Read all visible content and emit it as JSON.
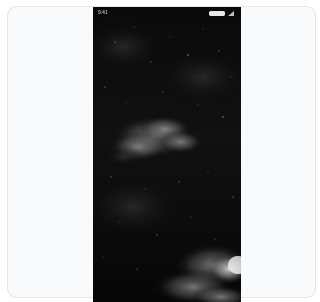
{
  "status_bar": {
    "time": "9:41"
  },
  "footer": {
    "line1": "",
    "line2": ""
  }
}
